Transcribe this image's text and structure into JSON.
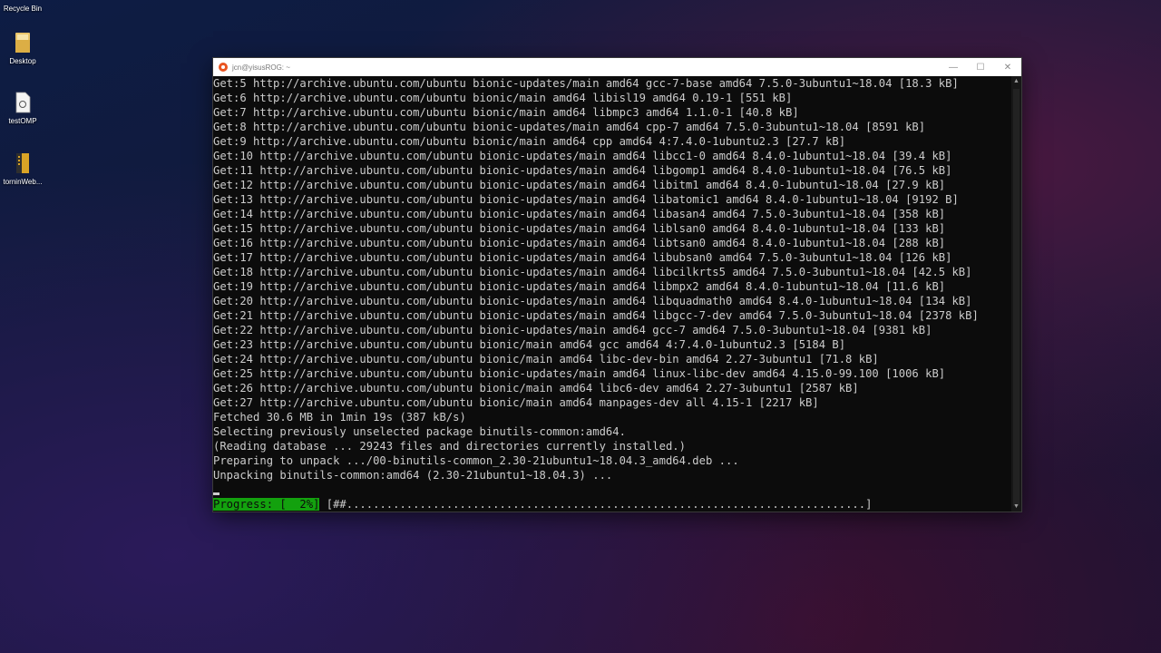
{
  "desktop": {
    "icons": [
      {
        "label": "Recycle Bin",
        "icon": "recycle-bin-icon"
      },
      {
        "label": "Desktop",
        "icon": "folder-icon"
      },
      {
        "label": "testOMP",
        "icon": "file-icon"
      },
      {
        "label": "torninWeb...",
        "icon": "archive-icon"
      }
    ]
  },
  "window": {
    "title": "jcn@yisusROG: ~",
    "icon": "ubuntu-icon",
    "accent_color": "#e95420",
    "controls": {
      "minimize": "—",
      "maximize": "☐",
      "close": "✕"
    }
  },
  "terminal": {
    "lines": [
      "Get:5 http://archive.ubuntu.com/ubuntu bionic-updates/main amd64 gcc-7-base amd64 7.5.0-3ubuntu1~18.04 [18.3 kB]",
      "Get:6 http://archive.ubuntu.com/ubuntu bionic/main amd64 libisl19 amd64 0.19-1 [551 kB]",
      "Get:7 http://archive.ubuntu.com/ubuntu bionic/main amd64 libmpc3 amd64 1.1.0-1 [40.8 kB]",
      "Get:8 http://archive.ubuntu.com/ubuntu bionic-updates/main amd64 cpp-7 amd64 7.5.0-3ubuntu1~18.04 [8591 kB]",
      "Get:9 http://archive.ubuntu.com/ubuntu bionic/main amd64 cpp amd64 4:7.4.0-1ubuntu2.3 [27.7 kB]",
      "Get:10 http://archive.ubuntu.com/ubuntu bionic-updates/main amd64 libcc1-0 amd64 8.4.0-1ubuntu1~18.04 [39.4 kB]",
      "Get:11 http://archive.ubuntu.com/ubuntu bionic-updates/main amd64 libgomp1 amd64 8.4.0-1ubuntu1~18.04 [76.5 kB]",
      "Get:12 http://archive.ubuntu.com/ubuntu bionic-updates/main amd64 libitm1 amd64 8.4.0-1ubuntu1~18.04 [27.9 kB]",
      "Get:13 http://archive.ubuntu.com/ubuntu bionic-updates/main amd64 libatomic1 amd64 8.4.0-1ubuntu1~18.04 [9192 B]",
      "Get:14 http://archive.ubuntu.com/ubuntu bionic-updates/main amd64 libasan4 amd64 7.5.0-3ubuntu1~18.04 [358 kB]",
      "Get:15 http://archive.ubuntu.com/ubuntu bionic-updates/main amd64 liblsan0 amd64 8.4.0-1ubuntu1~18.04 [133 kB]",
      "Get:16 http://archive.ubuntu.com/ubuntu bionic-updates/main amd64 libtsan0 amd64 8.4.0-1ubuntu1~18.04 [288 kB]",
      "Get:17 http://archive.ubuntu.com/ubuntu bionic-updates/main amd64 libubsan0 amd64 7.5.0-3ubuntu1~18.04 [126 kB]",
      "Get:18 http://archive.ubuntu.com/ubuntu bionic-updates/main amd64 libcilkrts5 amd64 7.5.0-3ubuntu1~18.04 [42.5 kB]",
      "Get:19 http://archive.ubuntu.com/ubuntu bionic-updates/main amd64 libmpx2 amd64 8.4.0-1ubuntu1~18.04 [11.6 kB]",
      "Get:20 http://archive.ubuntu.com/ubuntu bionic-updates/main amd64 libquadmath0 amd64 8.4.0-1ubuntu1~18.04 [134 kB]",
      "Get:21 http://archive.ubuntu.com/ubuntu bionic-updates/main amd64 libgcc-7-dev amd64 7.5.0-3ubuntu1~18.04 [2378 kB]",
      "Get:22 http://archive.ubuntu.com/ubuntu bionic-updates/main amd64 gcc-7 amd64 7.5.0-3ubuntu1~18.04 [9381 kB]",
      "Get:23 http://archive.ubuntu.com/ubuntu bionic/main amd64 gcc amd64 4:7.4.0-1ubuntu2.3 [5184 B]",
      "Get:24 http://archive.ubuntu.com/ubuntu bionic/main amd64 libc-dev-bin amd64 2.27-3ubuntu1 [71.8 kB]",
      "Get:25 http://archive.ubuntu.com/ubuntu bionic-updates/main amd64 linux-libc-dev amd64 4.15.0-99.100 [1006 kB]",
      "Get:26 http://archive.ubuntu.com/ubuntu bionic/main amd64 libc6-dev amd64 2.27-3ubuntu1 [2587 kB]",
      "Get:27 http://archive.ubuntu.com/ubuntu bionic/main amd64 manpages-dev all 4.15-1 [2217 kB]",
      "Fetched 30.6 MB in 1min 19s (387 kB/s)",
      "Selecting previously unselected package binutils-common:amd64.",
      "(Reading database ... 29243 files and directories currently installed.)",
      "Preparing to unpack .../00-binutils-common_2.30-21ubuntu1~18.04.3_amd64.deb ...",
      "Unpacking binutils-common:amd64 (2.30-21ubuntu1~18.04.3) ..."
    ],
    "progress_label": "Progress: [  2%]",
    "progress_bar": "[##..............................................................................]",
    "progress_percent": 2,
    "fg_color": "#cccccc",
    "bg_color": "#0c0c0c",
    "progress_color": "#13a10e"
  }
}
